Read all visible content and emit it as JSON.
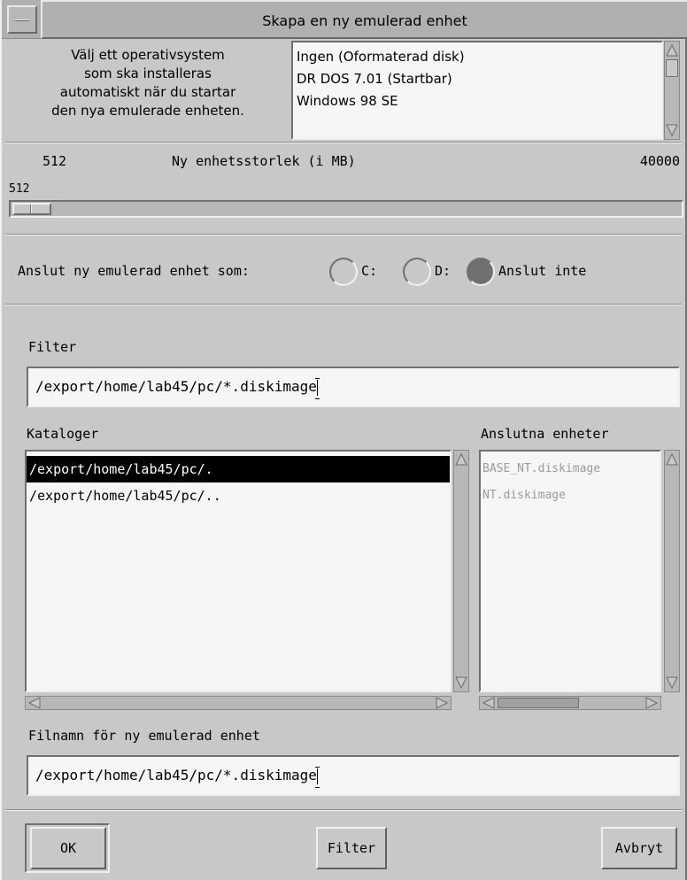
{
  "window": {
    "title": "Skapa en ny emulerad enhet"
  },
  "os_section": {
    "description_lines": [
      "Välj ett operativsystem",
      "som ska installeras",
      "automatiskt när du startar",
      "den nya emulerade enheten."
    ],
    "options": [
      "Ingen (Oformaterad disk)",
      "DR DOS 7.01 (Startbar)",
      "Windows 98 SE"
    ]
  },
  "size_section": {
    "min": "512",
    "label": "Ny enhetsstorlek (i MB)",
    "max": "40000",
    "current": "512"
  },
  "connect_section": {
    "label": "Anslut ny emulerad enhet som:",
    "options": [
      {
        "label": "C:",
        "selected": false
      },
      {
        "label": "D:",
        "selected": false
      },
      {
        "label": "Anslut inte",
        "selected": true
      }
    ]
  },
  "filter_section": {
    "label": "Filter",
    "value": "/export/home/lab45/pc/*.diskimage"
  },
  "directories": {
    "label": "Kataloger",
    "items": [
      "/export/home/lab45/pc/.",
      "/export/home/lab45/pc/.."
    ],
    "selected_index": 0
  },
  "connected_devices": {
    "label": "Anslutna enheter",
    "items": [
      "BASE_NT.diskimage",
      "NT.diskimage"
    ]
  },
  "filename_section": {
    "label": "Filnamn för ny emulerad enhet",
    "value": "/export/home/lab45/pc/*.diskimage"
  },
  "buttons": {
    "ok": "OK",
    "filter": "Filter",
    "cancel": "Avbryt"
  }
}
